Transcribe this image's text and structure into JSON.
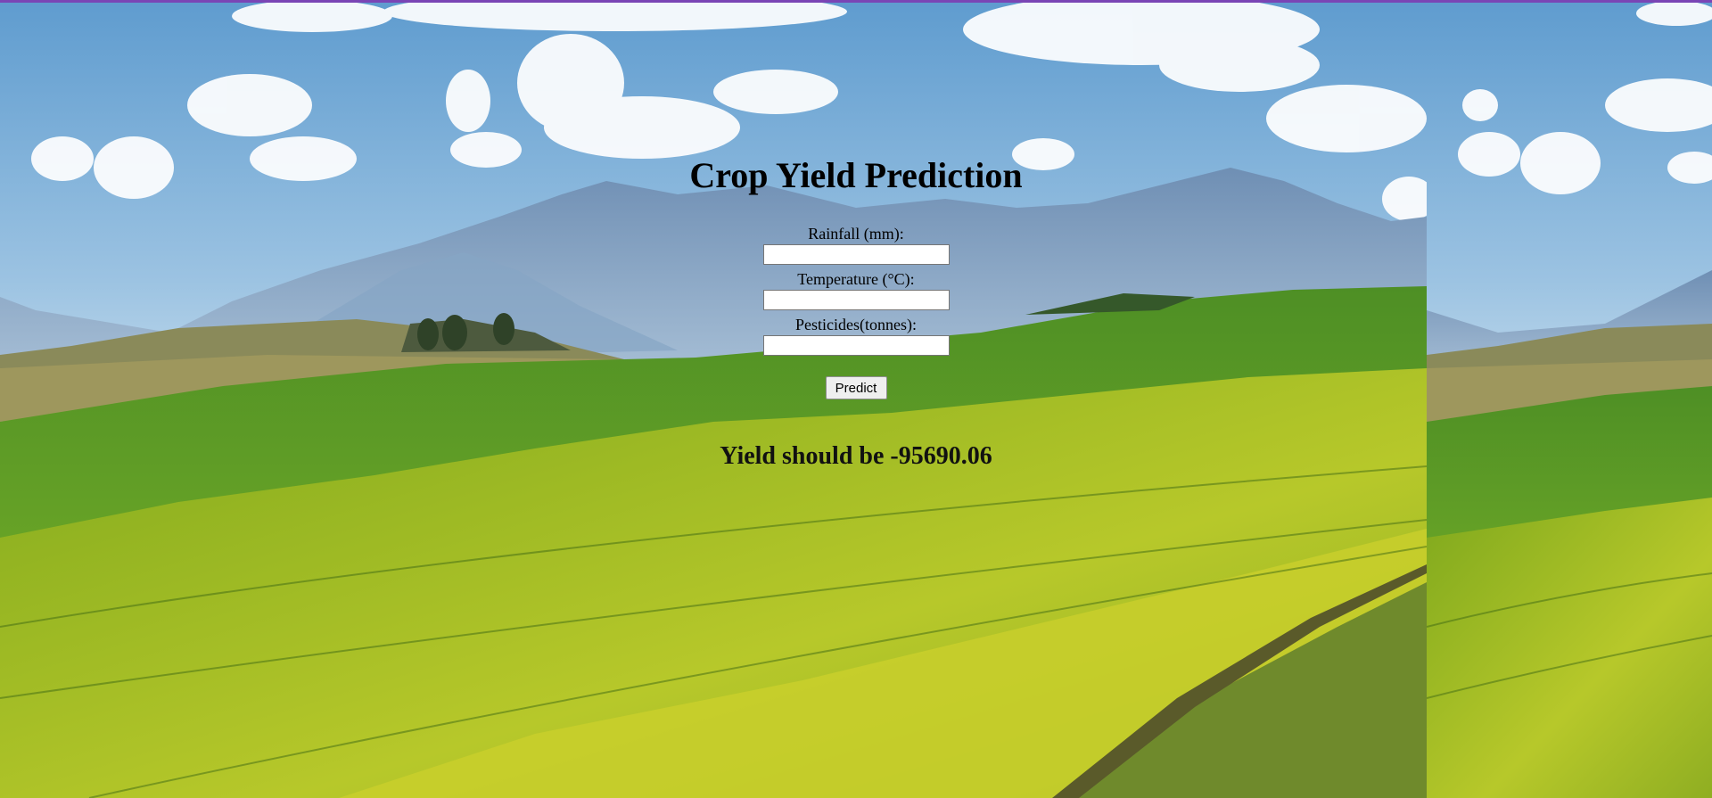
{
  "page": {
    "title": "Crop Yield Prediction",
    "background": "landscape-photo: cloudy blue sky, mountains, rolling green and yellow fields"
  },
  "form": {
    "fields": [
      {
        "label": "Rainfall (mm):",
        "value": "",
        "placeholder": ""
      },
      {
        "label": "Temperature (°C):",
        "value": "",
        "placeholder": ""
      },
      {
        "label": "Pesticides(tonnes):",
        "value": "",
        "placeholder": ""
      }
    ],
    "submit_label": "Predict"
  },
  "result": {
    "text": "Yield should be -95690.06"
  },
  "colors": {
    "top_border": "#7a45b5",
    "sky": "#6fa6d6",
    "field_green": "#4f8a1e",
    "field_yellow": "#c8cf2a"
  }
}
